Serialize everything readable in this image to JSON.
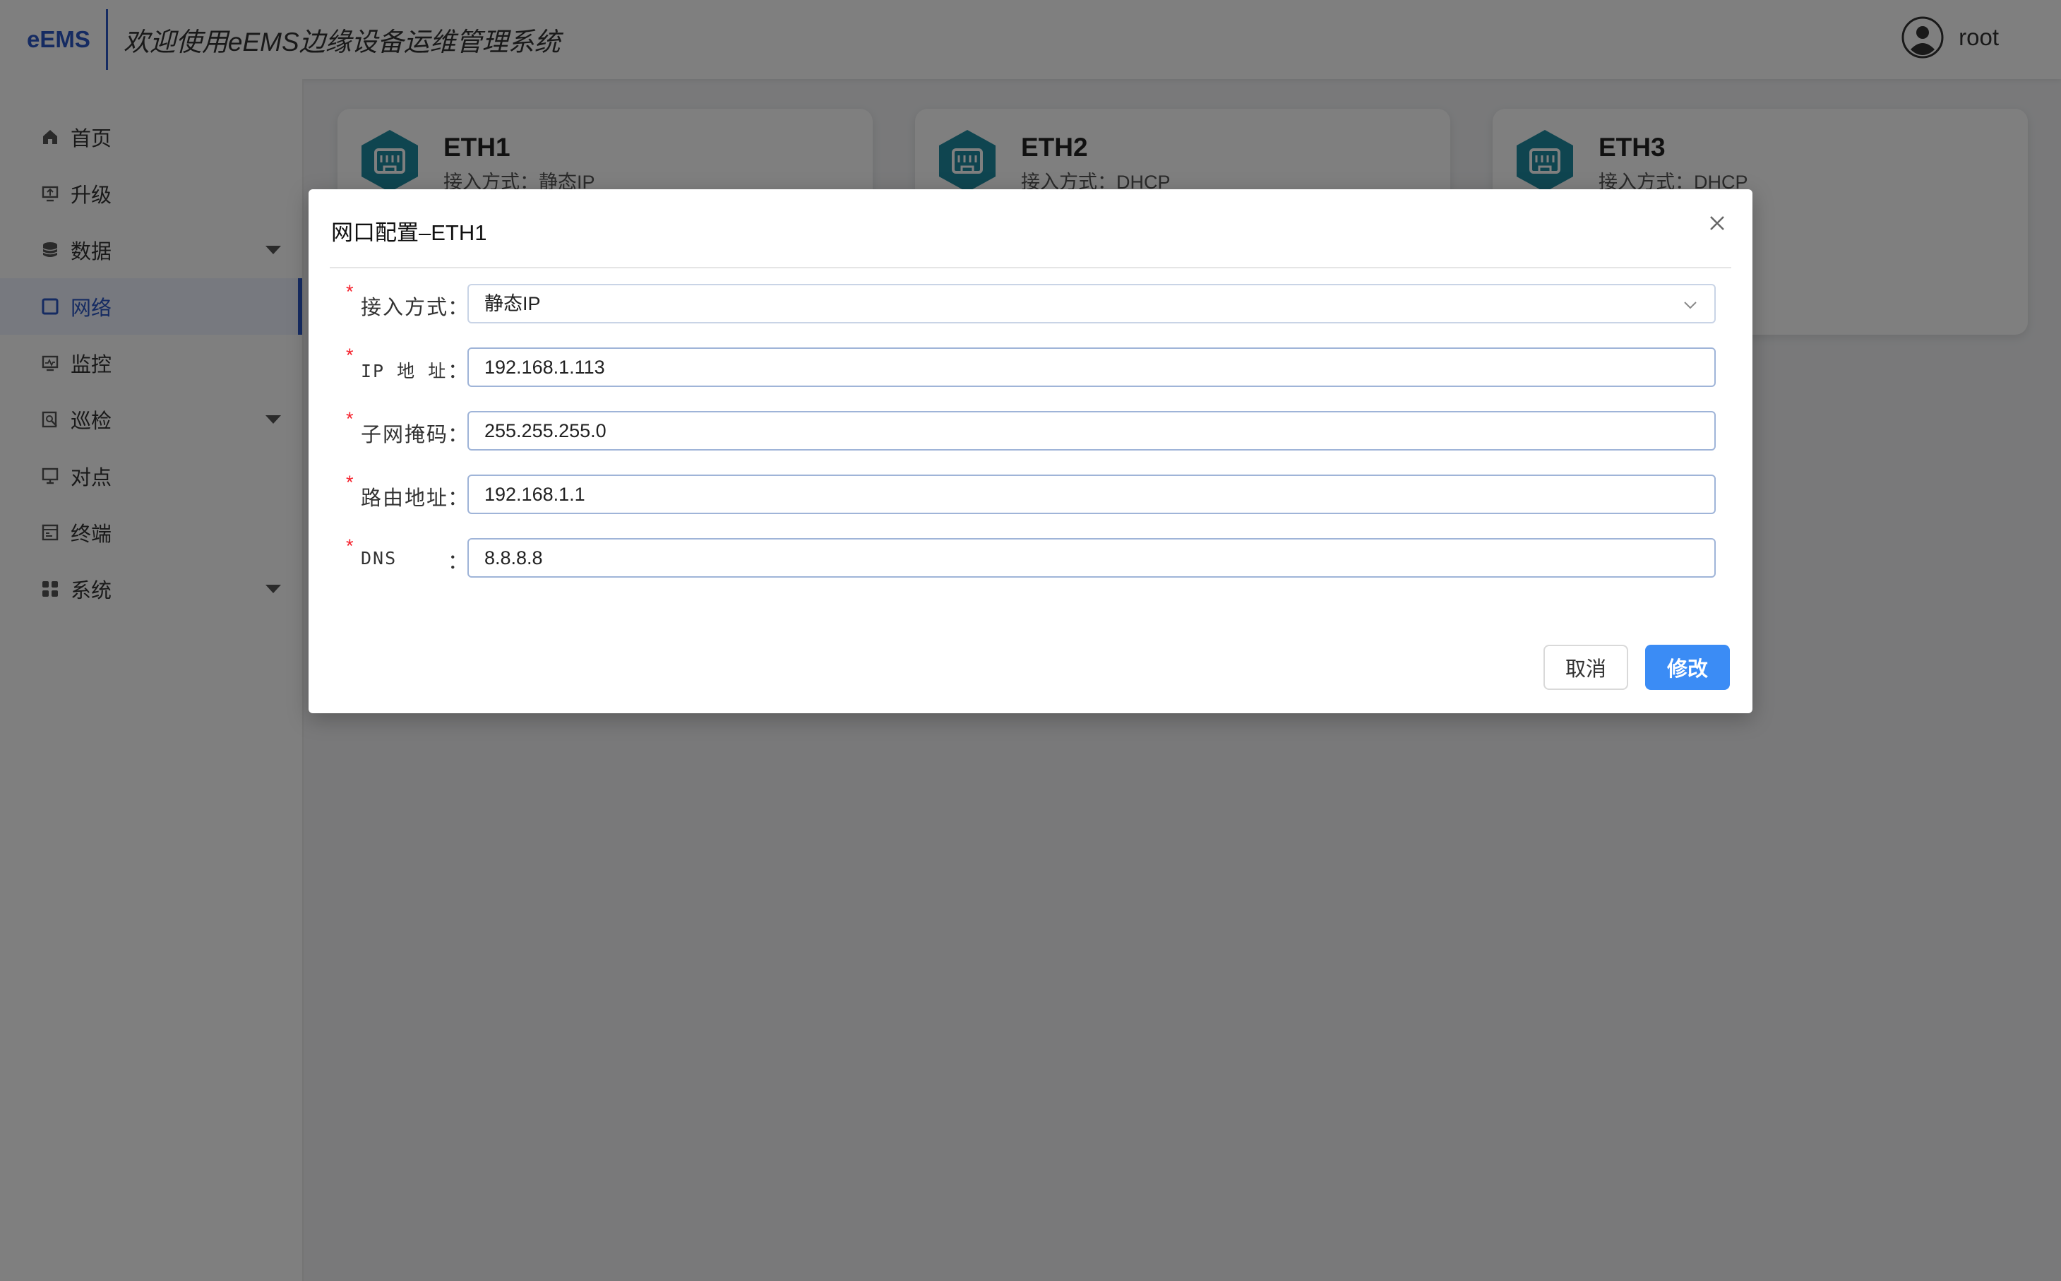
{
  "header": {
    "logo": "eEMS",
    "title": "欢迎使用eEMS边缘设备运维管理系统",
    "user_name": "root"
  },
  "sidebar": {
    "items": [
      {
        "label": "首页",
        "icon": "home-icon"
      },
      {
        "label": "升级",
        "icon": "upgrade-icon"
      },
      {
        "label": "数据",
        "icon": "database-icon"
      },
      {
        "label": "网络",
        "icon": "network-icon"
      },
      {
        "label": "监控",
        "icon": "monitor-icon"
      },
      {
        "label": "巡检",
        "icon": "inspection-icon"
      },
      {
        "label": "对点",
        "icon": "point-icon"
      },
      {
        "label": "终端",
        "icon": "terminal-icon"
      },
      {
        "label": "系统",
        "icon": "system-icon"
      }
    ]
  },
  "cards": [
    {
      "name": "ETH1",
      "mode": "接入方式：静态IP"
    },
    {
      "name": "ETH2",
      "mode": "接入方式：DHCP"
    },
    {
      "name": "ETH3",
      "mode": "接入方式：DHCP"
    }
  ],
  "modal": {
    "title": "网口配置–ETH1",
    "fields": [
      {
        "label": "接入方式",
        "value": "静态IP"
      },
      {
        "label": "IP 地 址",
        "value": "192.168.1.113"
      },
      {
        "label": "子网掩码",
        "value": "255.255.255.0"
      },
      {
        "label": "路由地址",
        "value": "192.168.1.1"
      },
      {
        "label": "DNS",
        "value": "8.8.8.8"
      }
    ],
    "required_mark": "*",
    "colon": "：",
    "cancel_label": "取消",
    "submit_label": "修改"
  },
  "colors": {
    "accent": "#2b56c4",
    "primary_button": "#3b8cf5",
    "card_icon": "#1f8aa0",
    "required": "#f5222d"
  }
}
